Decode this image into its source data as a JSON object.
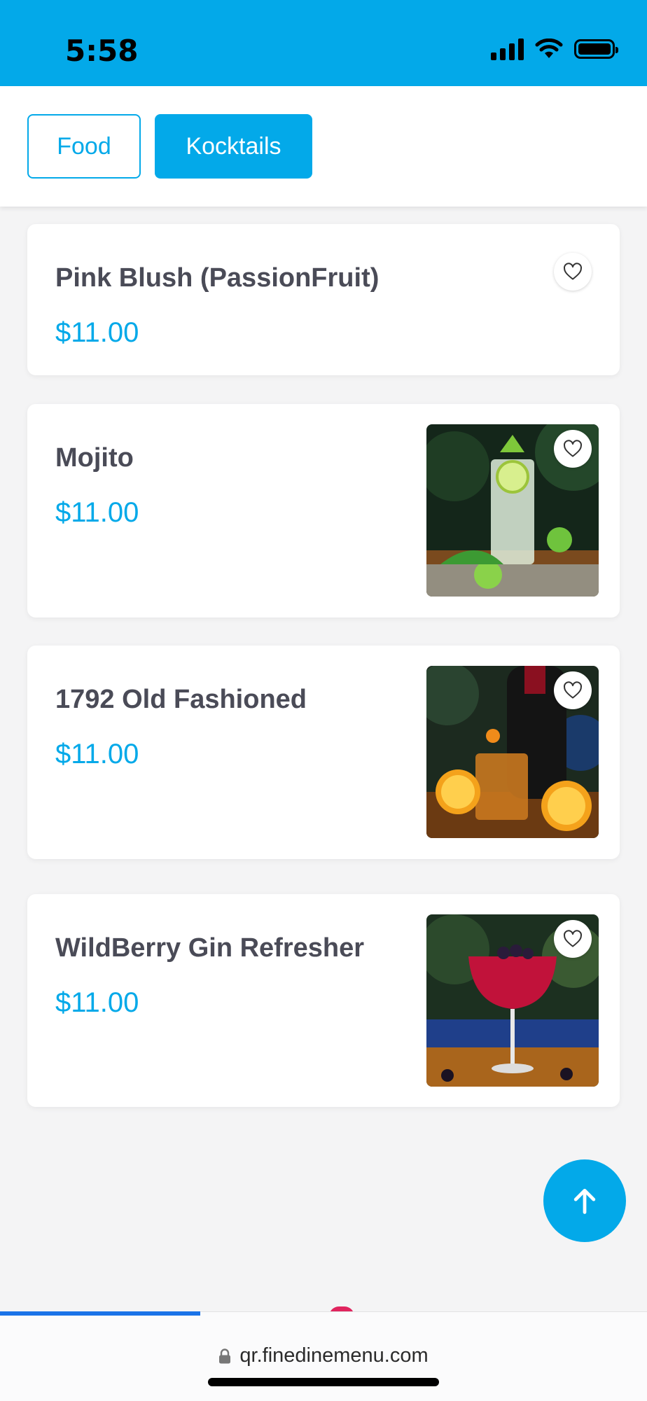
{
  "status_bar": {
    "time": "5:58",
    "icons": [
      "signal-icon",
      "wifi-icon",
      "battery-icon"
    ]
  },
  "tabs": [
    {
      "label": "Food",
      "selected": false
    },
    {
      "label": "Kocktails",
      "selected": true
    }
  ],
  "items": [
    {
      "name": "Pink Blush (PassionFruit)",
      "price": "$11.00",
      "has_photo": false,
      "favorite_icon": "heart-icon"
    },
    {
      "name": "Mojito",
      "price": "$11.00",
      "has_photo": true,
      "favorite_icon": "heart-icon"
    },
    {
      "name": "1792 Old Fashioned",
      "price": "$11.00",
      "has_photo": true,
      "favorite_icon": "heart-icon"
    },
    {
      "name": "WildBerry Gin Refresher",
      "price": "$11.00",
      "has_photo": true,
      "favorite_icon": "heart-icon"
    }
  ],
  "scroll_top_icon": "arrow-up-icon",
  "browser": {
    "url": "qr.finedinemenu.com",
    "lock_icon": "lock-icon",
    "load_progress": 0.31
  },
  "colors": {
    "accent": "#03a9e9",
    "item_name": "#4a4b57",
    "background": "#f4f4f5"
  }
}
